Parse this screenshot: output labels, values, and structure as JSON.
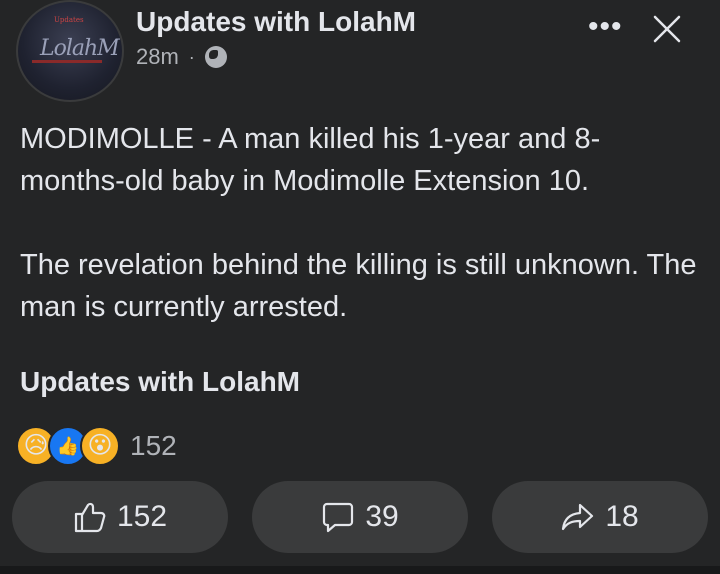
{
  "post": {
    "author": "Updates with LolahM",
    "time": "28m",
    "separator": "·",
    "privacy_icon": "globe-icon",
    "avatar_logo_top": "Updates",
    "avatar_logo_text": "LolahM",
    "paragraphs": [
      "MODIMOLLE - A man killed his 1-year and 8-months-old baby in Modimolle Extension 10.",
      "The revelation behind the killing is still unknown. The man is currently arrested."
    ],
    "signature": "Updates with LolahM"
  },
  "header": {
    "more_label": "•••",
    "close_icon": "close-icon"
  },
  "reactions": {
    "icons": [
      "sad-emoji-icon",
      "like-reaction-icon",
      "wow-emoji-icon"
    ],
    "sad_glyph": "😥",
    "like_glyph": "👍",
    "wow_glyph": "😮",
    "count": "152"
  },
  "actions": {
    "like_count": "152",
    "comment_count": "39",
    "share_count": "18"
  },
  "colors": {
    "background": "#242526",
    "button_bg": "#3a3b3c",
    "text_primary": "#e4e6eb",
    "text_secondary": "#b0b3b8",
    "like_blue": "#1877f2",
    "emoji_yellow": "#f7b125"
  }
}
